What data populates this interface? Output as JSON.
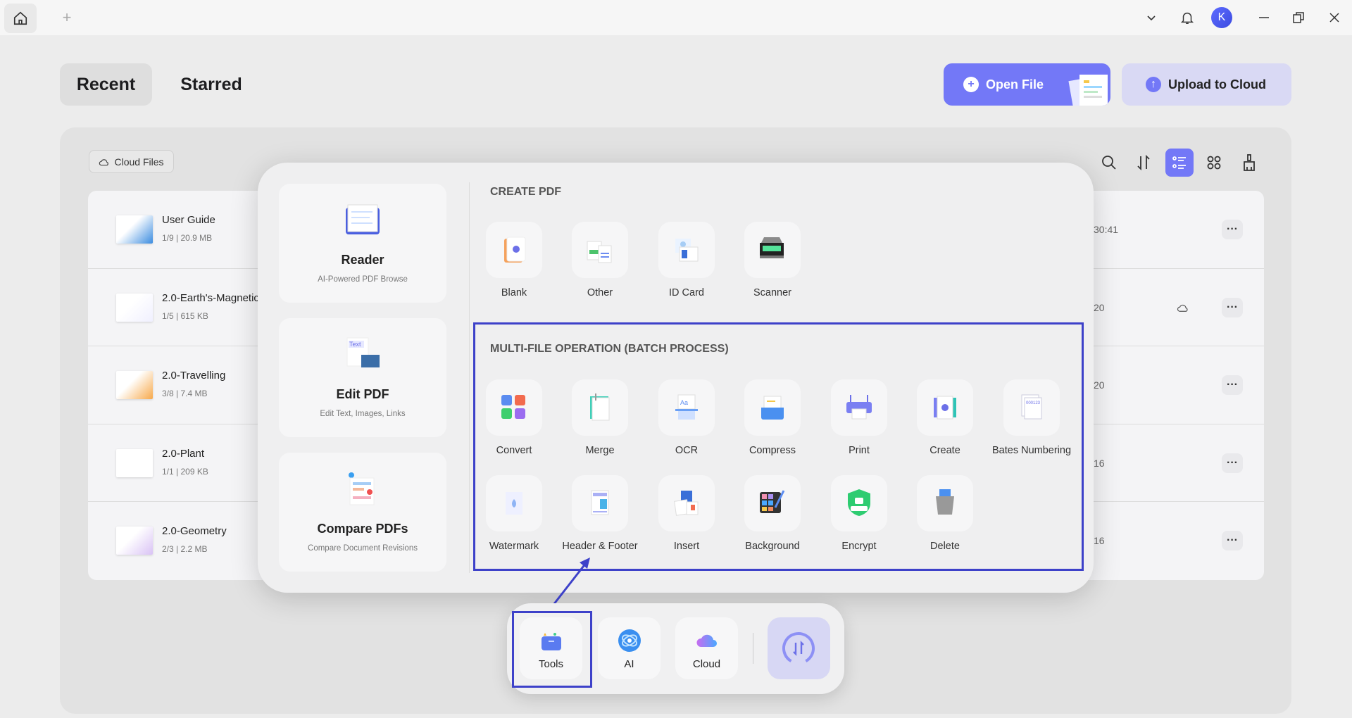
{
  "titlebar": {
    "home_icon": "home-icon",
    "new_tab_icon": "plus-icon",
    "avatar_letter": "K"
  },
  "tabs": {
    "recent": "Recent",
    "starred": "Starred"
  },
  "actions": {
    "open_file": "Open File",
    "upload": "Upload to Cloud"
  },
  "files_toolbar": {
    "cloud_files": "Cloud Files"
  },
  "files": [
    {
      "title": "User Guide",
      "meta": "1/9 | 20.9 MB",
      "time": "30:41",
      "cloud": false
    },
    {
      "title": "2.0-Earth's-Magnetic",
      "meta": "1/5 | 615 KB",
      "time": "20",
      "cloud": true
    },
    {
      "title": "2.0-Travelling",
      "meta": "3/8 | 7.4 MB",
      "time": "20",
      "cloud": false
    },
    {
      "title": "2.0-Plant",
      "meta": "1/1 | 209 KB",
      "time": "16",
      "cloud": false
    },
    {
      "title": "2.0-Geometry",
      "meta": "2/3 | 2.2 MB",
      "time": "16",
      "cloud": false
    }
  ],
  "more_label": "···",
  "popup": {
    "cards": [
      {
        "title": "Reader",
        "subtitle": "AI-Powered PDF Browse",
        "icon": "book-icon"
      },
      {
        "title": "Edit PDF",
        "subtitle": "Edit Text, Images, Links",
        "icon": "edit-text-icon"
      },
      {
        "title": "Compare PDFs",
        "subtitle": "Compare Document Revisions",
        "icon": "compare-icon"
      }
    ],
    "create_heading": "CREATE PDF",
    "create_tools": [
      {
        "label": "Blank",
        "icon": "blank"
      },
      {
        "label": "Other",
        "icon": "other"
      },
      {
        "label": "ID Card",
        "icon": "idcard"
      },
      {
        "label": "Scanner",
        "icon": "scanner"
      }
    ],
    "batch_heading": "MULTI-FILE OPERATION (BATCH PROCESS)",
    "batch_tools": [
      {
        "label": "Convert",
        "icon": "convert"
      },
      {
        "label": "Merge",
        "icon": "merge"
      },
      {
        "label": "OCR",
        "icon": "ocr"
      },
      {
        "label": "Compress",
        "icon": "compress"
      },
      {
        "label": "Print",
        "icon": "print"
      },
      {
        "label": "Create",
        "icon": "create"
      },
      {
        "label": "Bates Numbering",
        "icon": "bates"
      },
      {
        "label": "Watermark",
        "icon": "watermark"
      },
      {
        "label": "Header & Footer",
        "icon": "header"
      },
      {
        "label": "Insert",
        "icon": "insert"
      },
      {
        "label": "Background",
        "icon": "background"
      },
      {
        "label": "Encrypt",
        "icon": "encrypt"
      },
      {
        "label": "Delete",
        "icon": "delete"
      }
    ]
  },
  "dock": {
    "tools": "Tools",
    "ai": "AI",
    "cloud": "Cloud"
  },
  "colors": {
    "accent": "#7378f7",
    "highlight": "#3d41c9",
    "upload_bg": "#d9d9f4"
  }
}
